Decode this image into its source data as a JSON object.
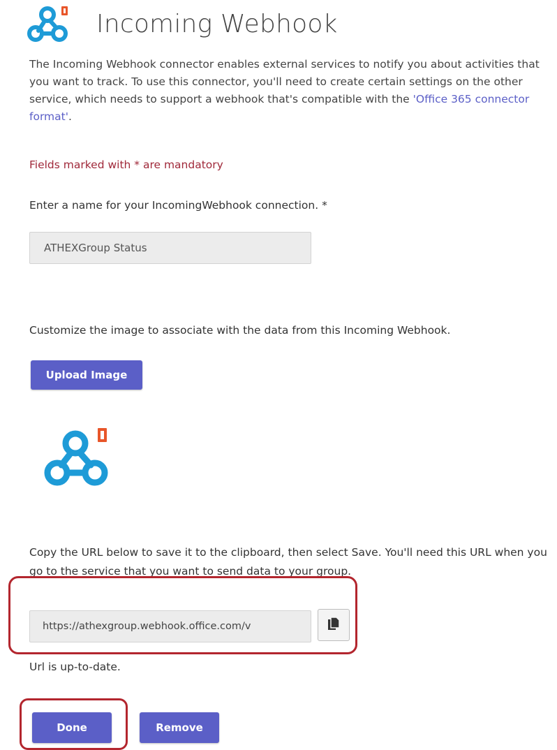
{
  "header": {
    "title": "Incoming Webhook",
    "logo_icon": "webhook-office-icon"
  },
  "intro": {
    "text_before_link": "The Incoming Webhook connector enables external services to notify you about activities that you want to track. To use this connector, you'll need to create certain settings on the other service, which needs to support a webhook that's compatible with the ",
    "link_text": "'Office 365 connector format'",
    "text_after_link": "."
  },
  "form": {
    "mandatory_note": "Fields marked with * are mandatory",
    "name_label": "Enter a name for your IncomingWebhook connection. *",
    "name_value": "ATHEXGroup Status",
    "image_label": "Customize the image to associate with the data from this Incoming Webhook.",
    "upload_button": "Upload Image",
    "copy_instructions": "Copy the URL below to save it to the clipboard, then select Save. You'll need this URL when you go to the service that you want to send data to your group.",
    "url_value": "https://athexgroup.webhook.office.com/v",
    "copy_icon": "copy-icon",
    "status_text": "Url is up-to-date.",
    "done_button": "Done",
    "remove_button": "Remove"
  },
  "colors": {
    "accent": "#5b5fc7",
    "highlight": "#b3262e",
    "mandatory": "#a0293a",
    "logo_blue": "#1e9bd7",
    "office_orange": "#e8562a"
  }
}
